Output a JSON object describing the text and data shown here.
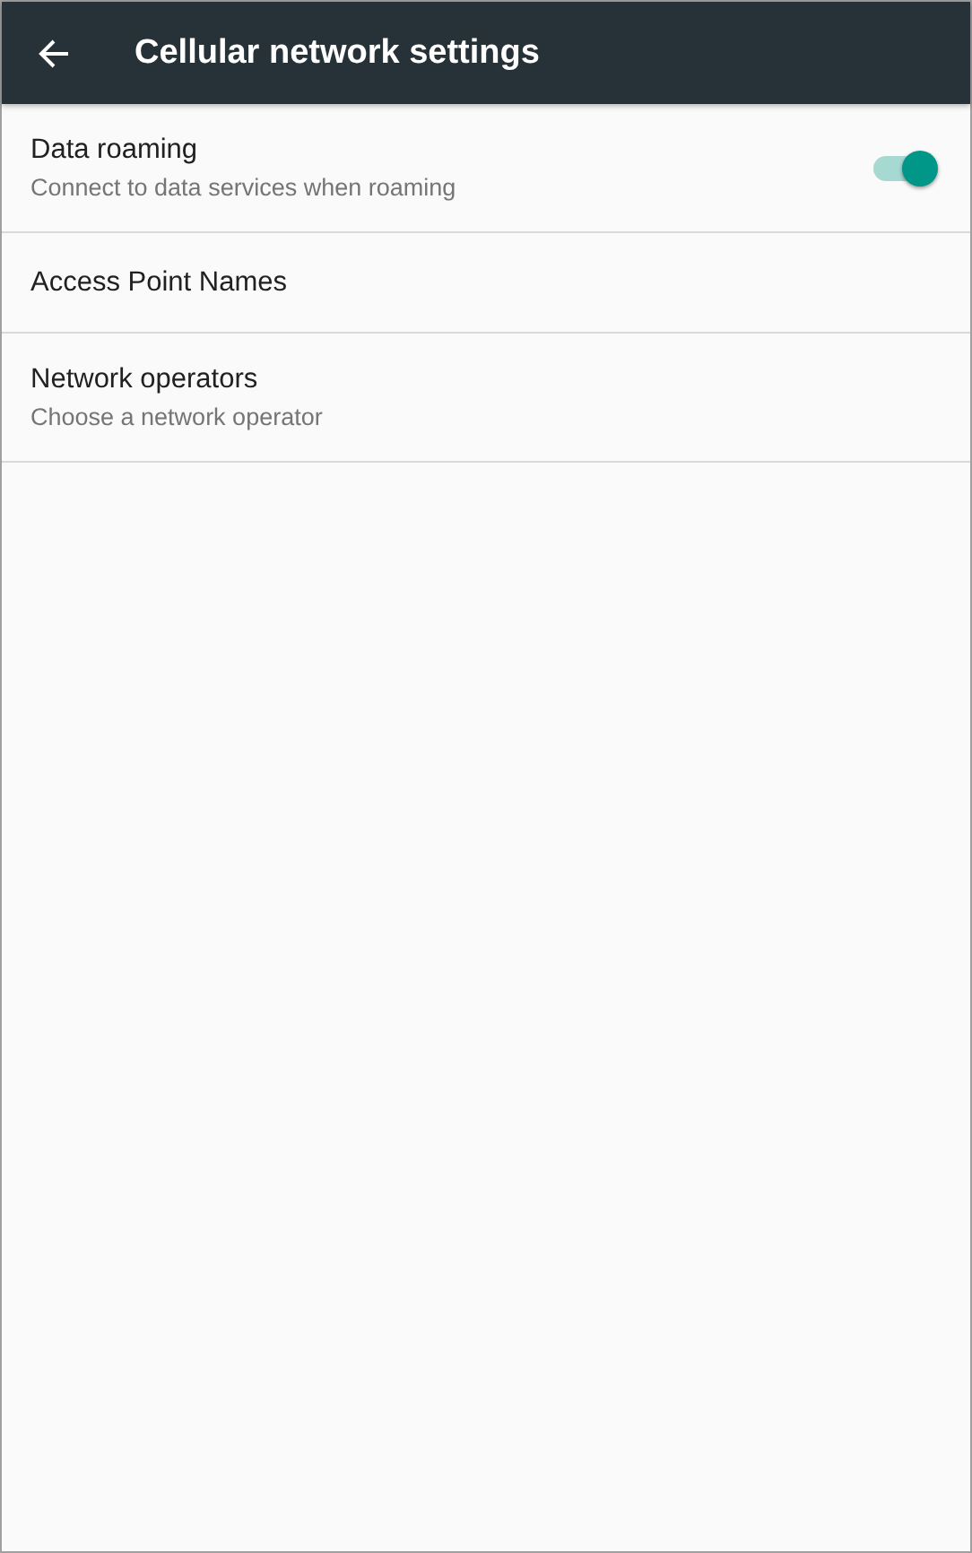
{
  "app_bar": {
    "title": "Cellular network settings"
  },
  "items": [
    {
      "kind": "switch",
      "title": "Data roaming",
      "summary": "Connect to data services when roaming",
      "on": true
    },
    {
      "kind": "plain",
      "title": "Access Point Names"
    },
    {
      "kind": "plain",
      "title": "Network operators",
      "summary": "Choose a network operator"
    }
  ]
}
